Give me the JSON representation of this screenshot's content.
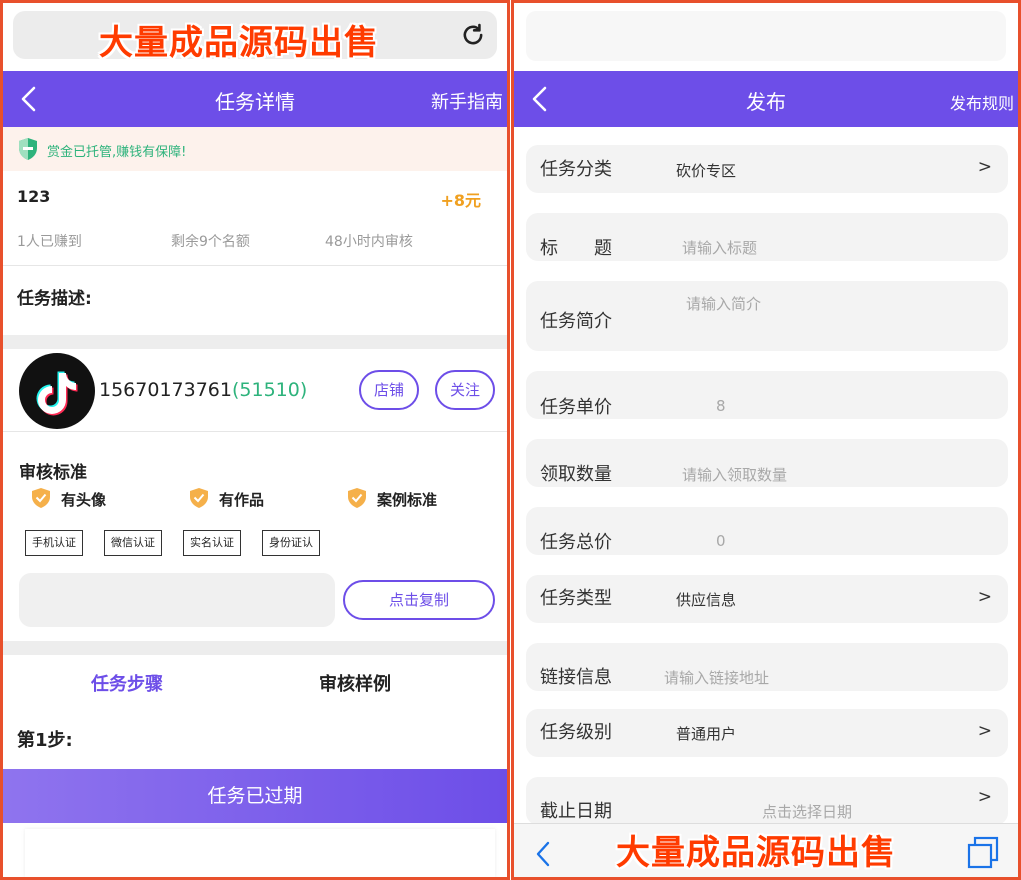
{
  "watermark": "大量成品源码出售",
  "left": {
    "header": {
      "title": "任务详情",
      "guide_link": "新手指南"
    },
    "escrow_notice": "赏金已托管,赚钱有保障!",
    "task": {
      "name": "123",
      "reward": "+8元"
    },
    "stats": [
      "1人已赚到",
      "剩余9个名额",
      "48小时内审核"
    ],
    "description_label": "任务描述:",
    "publisher": {
      "phone": "15670173761",
      "code": "(51510)",
      "shop_button": "店铺",
      "follow_button": "关注"
    },
    "audit": {
      "title": "审核标准",
      "badges": [
        "有头像",
        "有作品",
        "案例标准"
      ],
      "tags": [
        "手机认证",
        "微信认证",
        "实名认证",
        "身份证认"
      ]
    },
    "copy_button": "点击复制",
    "tabs": [
      "任务步骤",
      "审核样例"
    ],
    "step_label": "第1步:",
    "status_button": "任务已过期",
    "colors": {
      "primary": "#6d4ee8",
      "green": "#2eb37c",
      "orange": "#f0a020"
    }
  },
  "right": {
    "header": {
      "title": "发布",
      "rules_link": "发布规则"
    },
    "fields": [
      {
        "label": "任务分类",
        "value": "砍价专区",
        "arrow": ">"
      },
      {
        "label": "标　　题",
        "placeholder": "请输入标题"
      },
      {
        "label": "任务简介",
        "placeholder": "请输入简介"
      },
      {
        "label": "任务单价",
        "placeholder": "8"
      },
      {
        "label": "领取数量",
        "placeholder": "请输入领取数量"
      },
      {
        "label": "任务总价",
        "placeholder": "0"
      },
      {
        "label": "任务类型",
        "value": "供应信息",
        "arrow": ">"
      },
      {
        "label": "链接信息",
        "placeholder": "请输入链接地址"
      },
      {
        "label": "任务级别",
        "value": "普通用户",
        "arrow": ">"
      },
      {
        "label": "截止日期",
        "placeholder": "点击选择日期",
        "arrow": ">"
      }
    ]
  }
}
